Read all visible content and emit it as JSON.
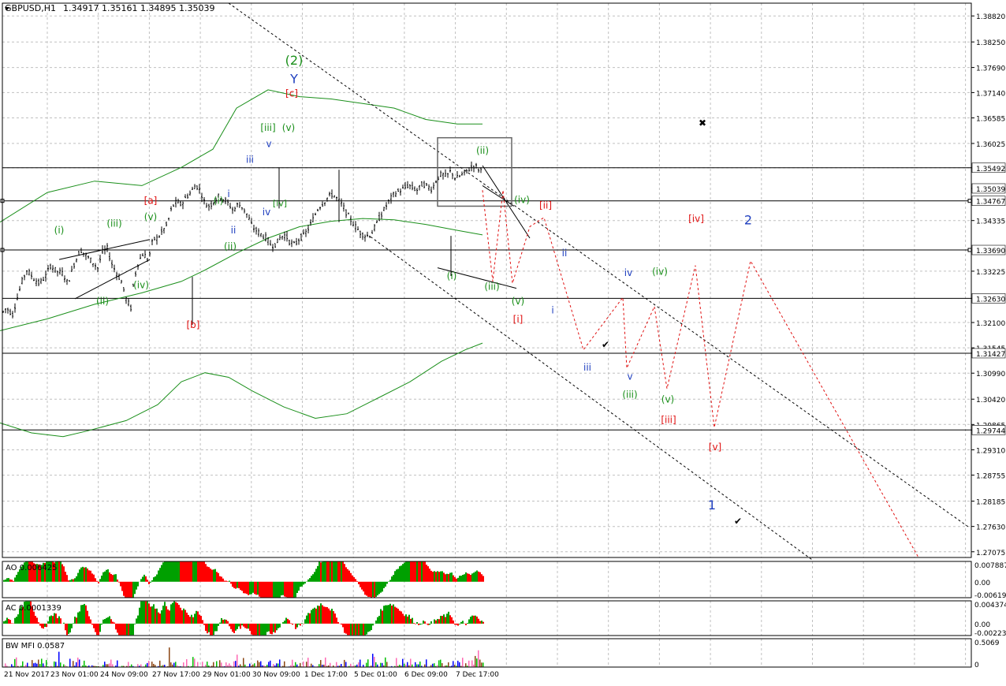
{
  "colors": {
    "background": "#ffffff",
    "grid": "#c0c0c0",
    "axis": "#000000",
    "bar": "#000000",
    "ma": "#1a8f1a",
    "label_green": "#1a8f1a",
    "label_blue": "#1f3fbf",
    "label_red": "#e01010",
    "forecast": "#e01010",
    "ao_up": "#00a000",
    "ao_down": "#ff0000",
    "mfi_green": "#00c000",
    "mfi_blue": "#0000ff",
    "mfi_brown": "#8b4513",
    "mfi_pink": "#ff69b4"
  },
  "chart_data": [
    {
      "type": "candlestick-ohlc",
      "name": "main",
      "header": {
        "symbol": "GBPUSD,H1",
        "ohlc": "1.34917 1.35161 1.34895 1.35039"
      },
      "ylim": [
        1.2695,
        1.391
      ],
      "y_ticks": [
        "1.38820",
        "1.38250",
        "1.37690",
        "1.37140",
        "1.36585",
        "1.36025",
        "1.35492",
        "1.35039",
        "1.34767",
        "1.34335",
        "1.33690",
        "1.33225",
        "1.32630",
        "1.32100",
        "1.31545",
        "1.31427",
        "1.30990",
        "1.30420",
        "1.29865",
        "1.29744",
        "1.29310",
        "1.28755",
        "1.28185",
        "1.27630",
        "1.27075"
      ],
      "price_levels": [
        1.35492,
        1.34767,
        1.3369,
        1.3263,
        1.31427,
        1.29744
      ],
      "highlight_tags": [
        "1.35492",
        "1.35039",
        "1.34767",
        "1.33690",
        "1.32630",
        "1.31427",
        "1.29744"
      ],
      "x_ticks": [
        "21 Nov 2017",
        "23 Nov 01:00",
        "24 Nov 09:00",
        "27 Nov 17:00",
        "29 Nov 01:00",
        "30 Nov 09:00",
        "1 Dec 17:00",
        "5 Dec 01:00",
        "6 Dec 09:00",
        "7 Dec 17:00"
      ],
      "price_path": [
        [
          0,
          1.3225
        ],
        [
          8,
          1.3242
        ],
        [
          16,
          1.3228
        ],
        [
          22,
          1.3265
        ],
        [
          28,
          1.33
        ],
        [
          34,
          1.3325
        ],
        [
          42,
          1.3308
        ],
        [
          50,
          1.3295
        ],
        [
          58,
          1.3312
        ],
        [
          64,
          1.3335
        ],
        [
          72,
          1.3322
        ],
        [
          80,
          1.3318
        ],
        [
          86,
          1.3295
        ],
        [
          94,
          1.3338
        ],
        [
          102,
          1.337
        ],
        [
          110,
          1.3355
        ],
        [
          116,
          1.3345
        ],
        [
          124,
          1.333
        ],
        [
          130,
          1.3365
        ],
        [
          136,
          1.3372
        ],
        [
          142,
          1.3338
        ],
        [
          148,
          1.3318
        ],
        [
          154,
          1.33
        ],
        [
          160,
          1.3262
        ],
        [
          166,
          1.3242
        ],
        [
          170,
          1.3305
        ],
        [
          176,
          1.3345
        ],
        [
          182,
          1.3362
        ],
        [
          188,
          1.3345
        ],
        [
          194,
          1.3392
        ],
        [
          200,
          1.3395
        ],
        [
          206,
          1.341
        ],
        [
          212,
          1.3425
        ],
        [
          218,
          1.3462
        ],
        [
          224,
          1.3475
        ],
        [
          230,
          1.3468
        ],
        [
          236,
          1.3485
        ],
        [
          242,
          1.3495
        ],
        [
          248,
          1.3512
        ],
        [
          254,
          1.35
        ],
        [
          260,
          1.347
        ],
        [
          266,
          1.3465
        ],
        [
          272,
          1.3478
        ],
        [
          278,
          1.3488
        ],
        [
          284,
          1.348
        ],
        [
          290,
          1.347
        ],
        [
          296,
          1.3455
        ],
        [
          302,
          1.347
        ],
        [
          308,
          1.3462
        ],
        [
          314,
          1.3445
        ],
        [
          320,
          1.342
        ],
        [
          326,
          1.341
        ],
        [
          332,
          1.3402
        ],
        [
          338,
          1.3395
        ],
        [
          344,
          1.3378
        ],
        [
          350,
          1.3382
        ],
        [
          356,
          1.3398
        ],
        [
          362,
          1.3402
        ],
        [
          368,
          1.3385
        ],
        [
          374,
          1.338
        ],
        [
          380,
          1.3395
        ],
        [
          386,
          1.3402
        ],
        [
          392,
          1.3418
        ],
        [
          398,
          1.344
        ],
        [
          404,
          1.3462
        ],
        [
          410,
          1.3472
        ],
        [
          416,
          1.3485
        ],
        [
          422,
          1.3492
        ],
        [
          428,
          1.348
        ],
        [
          434,
          1.3468
        ],
        [
          440,
          1.3448
        ],
        [
          446,
          1.3432
        ],
        [
          452,
          1.3418
        ],
        [
          458,
          1.3405
        ],
        [
          464,
          1.34
        ],
        [
          470,
          1.3402
        ],
        [
          476,
          1.342
        ],
        [
          482,
          1.3442
        ],
        [
          488,
          1.346
        ],
        [
          494,
          1.3478
        ],
        [
          500,
          1.3492
        ],
        [
          506,
          1.3498
        ],
        [
          512,
          1.3503
        ],
        [
          518,
          1.3512
        ],
        [
          524,
          1.3504
        ],
        [
          530,
          1.35
        ],
        [
          536,
          1.3515
        ],
        [
          542,
          1.3508
        ],
        [
          548,
          1.3502
        ],
        [
          554,
          1.3525
        ],
        [
          560,
          1.3535
        ],
        [
          566,
          1.353
        ],
        [
          572,
          1.3542
        ],
        [
          578,
          1.3525
        ],
        [
          584,
          1.3532
        ],
        [
          590,
          1.3538
        ],
        [
          596,
          1.3548
        ],
        [
          602,
          1.3555
        ],
        [
          608,
          1.3544
        ]
      ],
      "ma_upper": [
        [
          0,
          1.343
        ],
        [
          60,
          1.3495
        ],
        [
          120,
          1.352
        ],
        [
          180,
          1.351
        ],
        [
          230,
          1.355
        ],
        [
          270,
          1.359
        ],
        [
          300,
          1.368
        ],
        [
          340,
          1.372
        ],
        [
          380,
          1.3705
        ],
        [
          420,
          1.37
        ],
        [
          460,
          1.369
        ],
        [
          500,
          1.368
        ],
        [
          540,
          1.3655
        ],
        [
          580,
          1.3645
        ],
        [
          612,
          1.3645
        ]
      ],
      "ma_middle": [
        [
          0,
          1.3192
        ],
        [
          60,
          1.3218
        ],
        [
          120,
          1.325
        ],
        [
          180,
          1.3275
        ],
        [
          230,
          1.33
        ],
        [
          260,
          1.3325
        ],
        [
          300,
          1.3362
        ],
        [
          340,
          1.3395
        ],
        [
          380,
          1.342
        ],
        [
          420,
          1.3432
        ],
        [
          460,
          1.3438
        ],
        [
          500,
          1.3435
        ],
        [
          540,
          1.3425
        ],
        [
          580,
          1.3412
        ],
        [
          612,
          1.3402
        ]
      ],
      "ma_lower": [
        [
          0,
          1.299
        ],
        [
          40,
          1.2968
        ],
        [
          80,
          1.296
        ],
        [
          110,
          1.2972
        ],
        [
          160,
          1.2995
        ],
        [
          200,
          1.303
        ],
        [
          230,
          1.308
        ],
        [
          260,
          1.31
        ],
        [
          290,
          1.309
        ],
        [
          320,
          1.306
        ],
        [
          360,
          1.3025
        ],
        [
          400,
          1.3
        ],
        [
          440,
          1.301
        ],
        [
          480,
          1.3045
        ],
        [
          520,
          1.308
        ],
        [
          560,
          1.3125
        ],
        [
          590,
          1.315
        ],
        [
          612,
          1.3165
        ]
      ],
      "triangle_lines": [
        [
          [
            75,
            1.3348
          ],
          [
            190,
            1.3392
          ]
        ],
        [
          [
            95,
            1.3262
          ],
          [
            190,
            1.3348
          ]
        ],
        [
          [
            555,
            1.333
          ],
          [
            655,
            1.3285
          ]
        ]
      ],
      "wedge_lines": [
        [
          [
            612,
            1.3554
          ],
          [
            672,
            1.3395
          ]
        ],
        [
          [
            612,
            1.351
          ],
          [
            652,
            1.3465
          ]
        ]
      ],
      "channel_lines": [
        [
          [
            290,
            1.391
          ],
          [
            1230,
            1.276
          ]
        ],
        [
          [
            470,
            1.3398
          ],
          [
            1030,
            1.269
          ]
        ]
      ],
      "forecast_path": [
        [
          612,
          1.35
        ],
        [
          625,
          1.33
        ],
        [
          638,
          1.35
        ],
        [
          650,
          1.3296
        ],
        [
          672,
          1.342
        ],
        [
          690,
          1.344
        ],
        [
          740,
          1.315
        ],
        [
          790,
          1.3265
        ],
        [
          795,
          1.311
        ],
        [
          830,
          1.3245
        ],
        [
          846,
          1.3065
        ],
        [
          882,
          1.3335
        ],
        [
          906,
          1.298
        ],
        [
          952,
          1.3345
        ],
        [
          1165,
          1.2695
        ]
      ],
      "box": {
        "x": [
          555,
          649
        ],
        "y": [
          1.3615,
          1.3465
        ]
      },
      "labels": [
        {
          "text": "(2)",
          "x": 373,
          "y": 1.3775,
          "color": "green",
          "size": 16
        },
        {
          "text": "Y",
          "x": 373,
          "y": 1.3735,
          "color": "blue",
          "size": 16
        },
        {
          "text": "[c]",
          "x": 370,
          "y": 1.3705,
          "color": "red",
          "size": 12
        },
        {
          "text": "[iii]",
          "x": 340,
          "y": 1.363,
          "color": "green",
          "size": 12
        },
        {
          "text": "(v)",
          "x": 366,
          "y": 1.363,
          "color": "green",
          "size": 12
        },
        {
          "text": "v",
          "x": 341,
          "y": 1.3595,
          "color": "blue",
          "size": 12
        },
        {
          "text": "iii",
          "x": 317,
          "y": 1.356,
          "color": "blue",
          "size": 12
        },
        {
          "text": "[iv]",
          "x": 355,
          "y": 1.3465,
          "color": "green",
          "size": 11
        },
        {
          "text": "iv",
          "x": 338,
          "y": 1.3445,
          "color": "blue",
          "size": 12
        },
        {
          "text": "i",
          "x": 290,
          "y": 1.3485,
          "color": "blue",
          "size": 12
        },
        {
          "text": "(i)",
          "x": 277,
          "y": 1.347,
          "color": "green",
          "size": 12
        },
        {
          "text": "ii",
          "x": 296,
          "y": 1.3405,
          "color": "blue",
          "size": 12
        },
        {
          "text": "(ii)",
          "x": 292,
          "y": 1.337,
          "color": "green",
          "size": 12
        },
        {
          "text": "[a]",
          "x": 191,
          "y": 1.347,
          "color": "red",
          "size": 12
        },
        {
          "text": "[b]",
          "x": 245,
          "y": 1.3198,
          "color": "red",
          "size": 12
        },
        {
          "text": "(i)",
          "x": 75,
          "y": 1.3405,
          "color": "green",
          "size": 12
        },
        {
          "text": "(iii)",
          "x": 145,
          "y": 1.342,
          "color": "green",
          "size": 12
        },
        {
          "text": "(v)",
          "x": 191,
          "y": 1.3435,
          "color": "green",
          "size": 12
        },
        {
          "text": "(ii)",
          "x": 130,
          "y": 1.325,
          "color": "green",
          "size": 12
        },
        {
          "text": "(iv)",
          "x": 179,
          "y": 1.3285,
          "color": "green",
          "size": 12
        },
        {
          "text": "(ii)",
          "x": 612,
          "y": 1.358,
          "color": "green",
          "size": 12
        },
        {
          "text": "(iv)",
          "x": 662,
          "y": 1.3472,
          "color": "green",
          "size": 12
        },
        {
          "text": "[ii]",
          "x": 692,
          "y": 1.346,
          "color": "red",
          "size": 12
        },
        {
          "text": "(i)",
          "x": 573,
          "y": 1.3305,
          "color": "green",
          "size": 12
        },
        {
          "text": "(iii)",
          "x": 624,
          "y": 1.3282,
          "color": "green",
          "size": 12
        },
        {
          "text": "(v)",
          "x": 657,
          "y": 1.325,
          "color": "green",
          "size": 12
        },
        {
          "text": "[i]",
          "x": 657,
          "y": 1.321,
          "color": "red",
          "size": 12
        },
        {
          "text": "ii",
          "x": 716,
          "y": 1.3355,
          "color": "blue",
          "size": 12
        },
        {
          "text": "i",
          "x": 701,
          "y": 1.323,
          "color": "blue",
          "size": 12
        },
        {
          "text": "iii",
          "x": 745,
          "y": 1.3105,
          "color": "blue",
          "size": 12
        },
        {
          "text": "iv",
          "x": 797,
          "y": 1.3312,
          "color": "blue",
          "size": 12
        },
        {
          "text": "v",
          "x": 799,
          "y": 1.3085,
          "color": "blue",
          "size": 12
        },
        {
          "text": "(iv)",
          "x": 837,
          "y": 1.3315,
          "color": "green",
          "size": 12
        },
        {
          "text": "(iii)",
          "x": 799,
          "y": 1.3045,
          "color": "green",
          "size": 12
        },
        {
          "text": "(v)",
          "x": 847,
          "y": 1.3035,
          "color": "green",
          "size": 12
        },
        {
          "text": "[iii]",
          "x": 848,
          "y": 1.299,
          "color": "red",
          "size": 12
        },
        {
          "text": "[iv]",
          "x": 883,
          "y": 1.343,
          "color": "red",
          "size": 12
        },
        {
          "text": "[v]",
          "x": 907,
          "y": 1.293,
          "color": "red",
          "size": 12
        },
        {
          "text": "2",
          "x": 949,
          "y": 1.3425,
          "color": "blue",
          "size": 16
        },
        {
          "text": "1",
          "x": 903,
          "y": 1.28,
          "color": "blue",
          "size": 16
        }
      ],
      "marks": [
        {
          "text": "✔",
          "x": 768,
          "y": 1.3155
        },
        {
          "text": "✔",
          "x": 936,
          "y": 1.2768
        },
        {
          "text": "✖",
          "x": 891,
          "y": 1.364
        }
      ]
    },
    {
      "type": "histogram",
      "name": "AO",
      "header": "AO 0.006425",
      "y_ticks": [
        "0.007887",
        "0.00",
        "-0.006197"
      ],
      "ylim": [
        -0.0062,
        0.0079
      ]
    },
    {
      "type": "histogram",
      "name": "AC",
      "header": "AC 0.0001339",
      "y_ticks": [
        "0.004374",
        "0.00",
        "-0.002233"
      ],
      "ylim": [
        -0.0023,
        0.0044
      ]
    },
    {
      "type": "histogram",
      "name": "BW MFI",
      "header": "BW MFI 0.0587",
      "y_ticks": [
        "0.5069",
        "0"
      ],
      "ylim": [
        0,
        0.5069
      ]
    }
  ]
}
